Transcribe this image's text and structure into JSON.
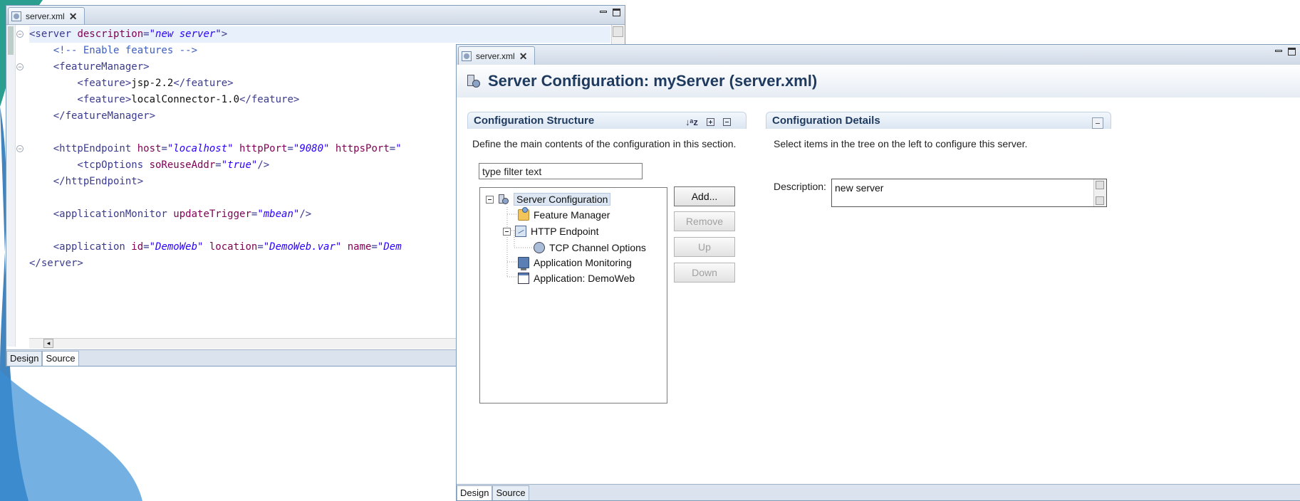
{
  "source_window": {
    "tab_label": "server.xml",
    "code_lines": [
      {
        "parts": [
          [
            "tag",
            "<server "
          ],
          [
            "attr",
            "description"
          ],
          [
            "tag",
            "="
          ],
          [
            "val",
            "\"new server\""
          ],
          [
            "tag",
            ">"
          ]
        ],
        "hl": true
      },
      {
        "parts": [
          [
            "cmt",
            "    <!-- Enable features -->"
          ]
        ]
      },
      {
        "parts": [
          [
            "tag",
            "    <featureManager>"
          ]
        ]
      },
      {
        "parts": [
          [
            "tag",
            "        <feature>"
          ],
          [
            "txt",
            "jsp-2.2"
          ],
          [
            "tag",
            "</feature>"
          ]
        ]
      },
      {
        "parts": [
          [
            "tag",
            "        <feature>"
          ],
          [
            "txt",
            "localConnector-1.0"
          ],
          [
            "tag",
            "</feature>"
          ]
        ]
      },
      {
        "parts": [
          [
            "tag",
            "    </featureManager>"
          ]
        ]
      },
      {
        "parts": []
      },
      {
        "parts": [
          [
            "tag",
            "    <httpEndpoint "
          ],
          [
            "attr",
            "host"
          ],
          [
            "tag",
            "="
          ],
          [
            "val",
            "\"localhost\""
          ],
          [
            "attr",
            " httpPort"
          ],
          [
            "tag",
            "="
          ],
          [
            "val",
            "\"9080\""
          ],
          [
            "attr",
            " httpsPort"
          ],
          [
            "tag",
            "="
          ],
          [
            "val",
            "\""
          ]
        ]
      },
      {
        "parts": [
          [
            "tag",
            "        <tcpOptions "
          ],
          [
            "attr",
            "soReuseAddr"
          ],
          [
            "tag",
            "="
          ],
          [
            "val",
            "\"true\""
          ],
          [
            "tag",
            "/>"
          ]
        ]
      },
      {
        "parts": [
          [
            "tag",
            "    </httpEndpoint>"
          ]
        ]
      },
      {
        "parts": []
      },
      {
        "parts": [
          [
            "tag",
            "    <applicationMonitor "
          ],
          [
            "attr",
            "updateTrigger"
          ],
          [
            "tag",
            "="
          ],
          [
            "val",
            "\"mbean\""
          ],
          [
            "tag",
            "/>"
          ]
        ]
      },
      {
        "parts": []
      },
      {
        "parts": [
          [
            "tag",
            "    <application "
          ],
          [
            "attr",
            "id"
          ],
          [
            "tag",
            "="
          ],
          [
            "val",
            "\"DemoWeb\""
          ],
          [
            "attr",
            " location"
          ],
          [
            "tag",
            "="
          ],
          [
            "val",
            "\"DemoWeb.var\""
          ],
          [
            "attr",
            " name"
          ],
          [
            "tag",
            "="
          ],
          [
            "val",
            "\"Dem"
          ]
        ]
      },
      {
        "parts": [
          [
            "tag",
            "</server>"
          ]
        ]
      }
    ],
    "bottom_tabs": {
      "design": "Design",
      "source": "Source"
    }
  },
  "design_window": {
    "tab_label": "server.xml",
    "title": "Server Configuration: myServer (server.xml)",
    "structure": {
      "heading": "Configuration Structure",
      "description": "Define the main contents of the configuration in this section.",
      "filter_placeholder": "type filter text",
      "tree": [
        {
          "label": "Server Configuration",
          "icon": "server-icon",
          "selected": true
        },
        {
          "label": "Feature Manager",
          "icon": "folder-icon"
        },
        {
          "label": "HTTP Endpoint",
          "icon": "http-endpoint-icon"
        },
        {
          "label": "TCP Channel Options",
          "icon": "globe-icon"
        },
        {
          "label": "Application Monitoring",
          "icon": "monitor-icon"
        },
        {
          "label": "Application: DemoWeb",
          "icon": "application-icon"
        }
      ],
      "buttons": {
        "add": "Add...",
        "remove": "Remove",
        "up": "Up",
        "down": "Down"
      }
    },
    "details": {
      "heading": "Configuration Details",
      "description": "Select items in the tree on the left to configure this server.",
      "field_label": "Description:",
      "field_value": "new server"
    },
    "bottom_tabs": {
      "design": "Design",
      "source": "Source"
    }
  },
  "colors": {
    "accent": "#1f3a5f",
    "swoosh_blue": "#1e6fb5",
    "swoosh_teal": "#2a9f8f"
  }
}
